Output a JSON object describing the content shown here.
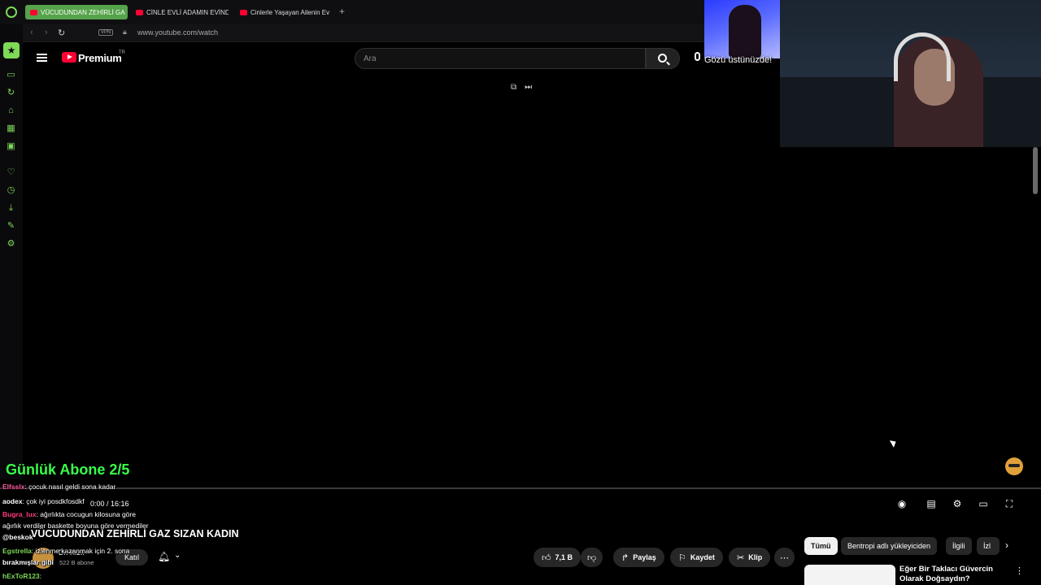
{
  "browser": {
    "tabs": [
      {
        "label": "VÜCUDUNDAN ZEHİRLİ GA",
        "active": true
      },
      {
        "label": "CİNLE EVLİ ADAMIN EVİNDE",
        "active": false
      },
      {
        "label": "Cinlerle Yaşayan Ailenin Ev",
        "active": false
      }
    ],
    "new_tab": "+",
    "vpn_badge": "VPN",
    "url": "www.youtube.com/watch",
    "accent": "#7ed957"
  },
  "youtube": {
    "brand": "Premium",
    "region": "TR",
    "search_placeholder": "Ara"
  },
  "overlay": {
    "cam_text": "Gözü üstünüzde!",
    "goal": "Günlük Abone 2/5"
  },
  "player": {
    "time": "0:00 / 16:16"
  },
  "video": {
    "title": "VÜCUDUNDAN ZEHİRLİ GAZ SIZAN KADIN",
    "channel": "Dr. Kızıl",
    "subscribers": "522 B abone",
    "join": "Katıl",
    "likes": "7,1 B",
    "share": "Paylaş",
    "save": "Kaydet",
    "clip": "Klip"
  },
  "related": {
    "chips": [
      "Tümü",
      "Bentropi adlı yükleyiciden",
      "İlgili",
      "İzl"
    ],
    "first_title": "Eğer Bir Taklacı Güvercin Olarak Doğsaydın?"
  },
  "chat": [
    {
      "user": "Elfsslx",
      "text": ": çocuk nasıl geldi sona kadar",
      "color": "#ff5aa0"
    },
    {
      "user": "aodex",
      "text": ": çok iyi posdkfosdkf",
      "color": "#ffffff"
    },
    {
      "user": "Bugra_lux",
      "text": ": ağırlıkta cocugun kilosuna göre",
      "color": "#ff3a7a"
    },
    {
      "user": "",
      "text": "ağırlık verdiler baskette boyuna göre vermediler",
      "color": "#ffffff"
    },
    {
      "user": "",
      "text": "@beskok",
      "color": "#ffffff"
    },
    {
      "user": "Egstrella",
      "text": ": izlenme kazanmak için 2. sona",
      "color": "#7ed957"
    },
    {
      "user": "",
      "text": "bırakmışlar gibi",
      "color": "#ffffff"
    },
    {
      "user": "hExToR123",
      "text": ":",
      "color": "#7ed957"
    }
  ]
}
